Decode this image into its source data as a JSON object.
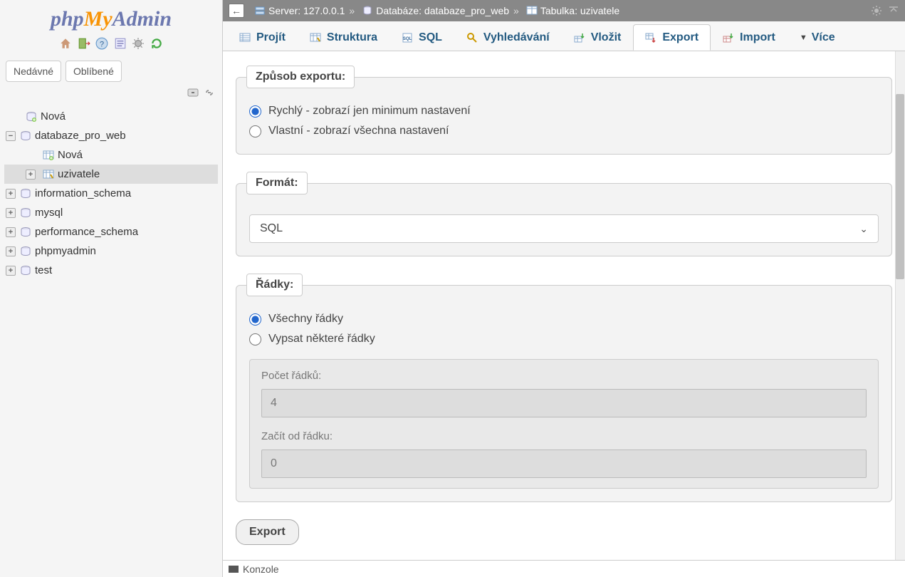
{
  "logo": {
    "php": "php",
    "my": "My",
    "admin": "Admin"
  },
  "sidebar_tabs": {
    "recent": "Nedávné",
    "favorites": "Oblíbené"
  },
  "tree": {
    "new_db": "Nová",
    "current_db": "databaze_pro_web",
    "new_table": "Nová",
    "current_table": "uzivatele",
    "others": [
      "information_schema",
      "mysql",
      "performance_schema",
      "phpmyadmin",
      "test"
    ]
  },
  "breadcrumb": {
    "server_label": "Server:",
    "server_value": "127.0.0.1",
    "db_label": "Databáze:",
    "db_value": "databaze_pro_web",
    "table_label": "Tabulka:",
    "table_value": "uzivatele"
  },
  "tabs": {
    "browse": "Projít",
    "structure": "Struktura",
    "sql": "SQL",
    "search": "Vyhledávání",
    "insert": "Vložit",
    "export": "Export",
    "import": "Import",
    "more": "Více"
  },
  "export_method": {
    "legend": "Způsob exportu:",
    "quick": "Rychlý - zobrazí jen minimum nastavení",
    "custom": "Vlastní - zobrazí všechna nastavení"
  },
  "format": {
    "legend": "Formát:",
    "value": "SQL"
  },
  "rows": {
    "legend": "Řádky:",
    "all": "Všechny řádky",
    "some": "Vypsat některé řádky",
    "count_label": "Počet řádků:",
    "count_value": "4",
    "start_label": "Začít od řádku:",
    "start_value": "0"
  },
  "export_button": "Export",
  "konzole": "Konzole"
}
